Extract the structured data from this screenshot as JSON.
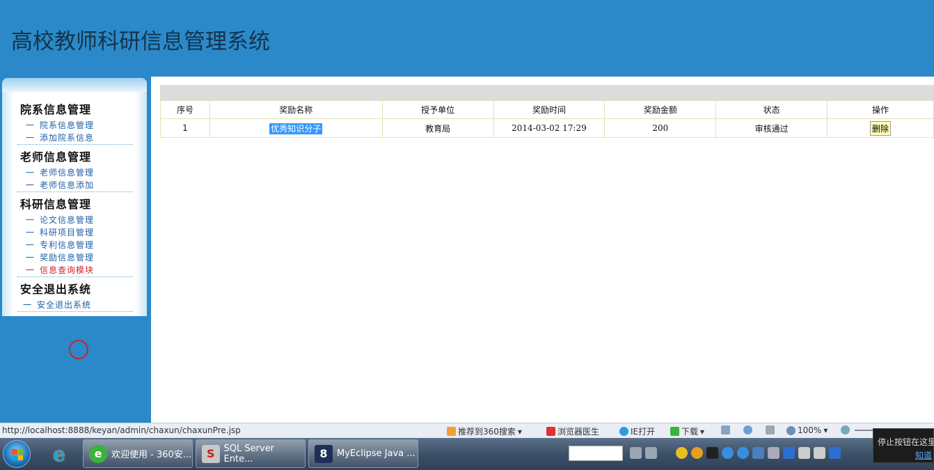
{
  "header": {
    "title": "高校教师科研信息管理系统"
  },
  "sidebar": {
    "groups": [
      {
        "title": "院系信息管理",
        "items": [
          "院系信息管理",
          "添加院系信息"
        ]
      },
      {
        "title": "老师信息管理",
        "items": [
          "老师信息管理",
          "老师信息添加"
        ]
      },
      {
        "title": "科研信息管理",
        "items": [
          "论文信息管理",
          "科研项目管理",
          "专利信息管理",
          "奖励信息管理",
          "信息查询模块"
        ]
      },
      {
        "title": "安全退出系统",
        "items": [
          "安全退出系统"
        ]
      }
    ],
    "dash": "一",
    "active_item": "信息查询模块"
  },
  "table": {
    "headers": [
      "序号",
      "奖励名称",
      "授予单位",
      "奖励时间",
      "奖励金额",
      "状态",
      "操作"
    ],
    "rows": [
      {
        "index": "1",
        "name": "优秀知识分子",
        "unit": "教育局",
        "time": "2014-03-02 17:29",
        "amount": "200",
        "status": "审核通过",
        "action": "删除"
      }
    ]
  },
  "statusbar": {
    "url": "http://localhost:8888/keyan/admin/chaxun/chaxunPre.jsp",
    "recommend": "推荐到360搜索",
    "doctor": "浏览器医生",
    "ie_open": "IE打开",
    "download": "下载",
    "zoom": "100%"
  },
  "taskbar": {
    "tasks": [
      "欢迎使用 - 360安...",
      "SQL Server Ente...",
      "MyEclipse Java ..."
    ]
  },
  "popup": {
    "line1": "停止按钮在这里",
    "line2": "知道"
  },
  "colors": {
    "header_bg": "#2b89c9",
    "active_menu": "#d0202a",
    "menu_link": "#1d5fa7",
    "selection": "#3399ff"
  }
}
